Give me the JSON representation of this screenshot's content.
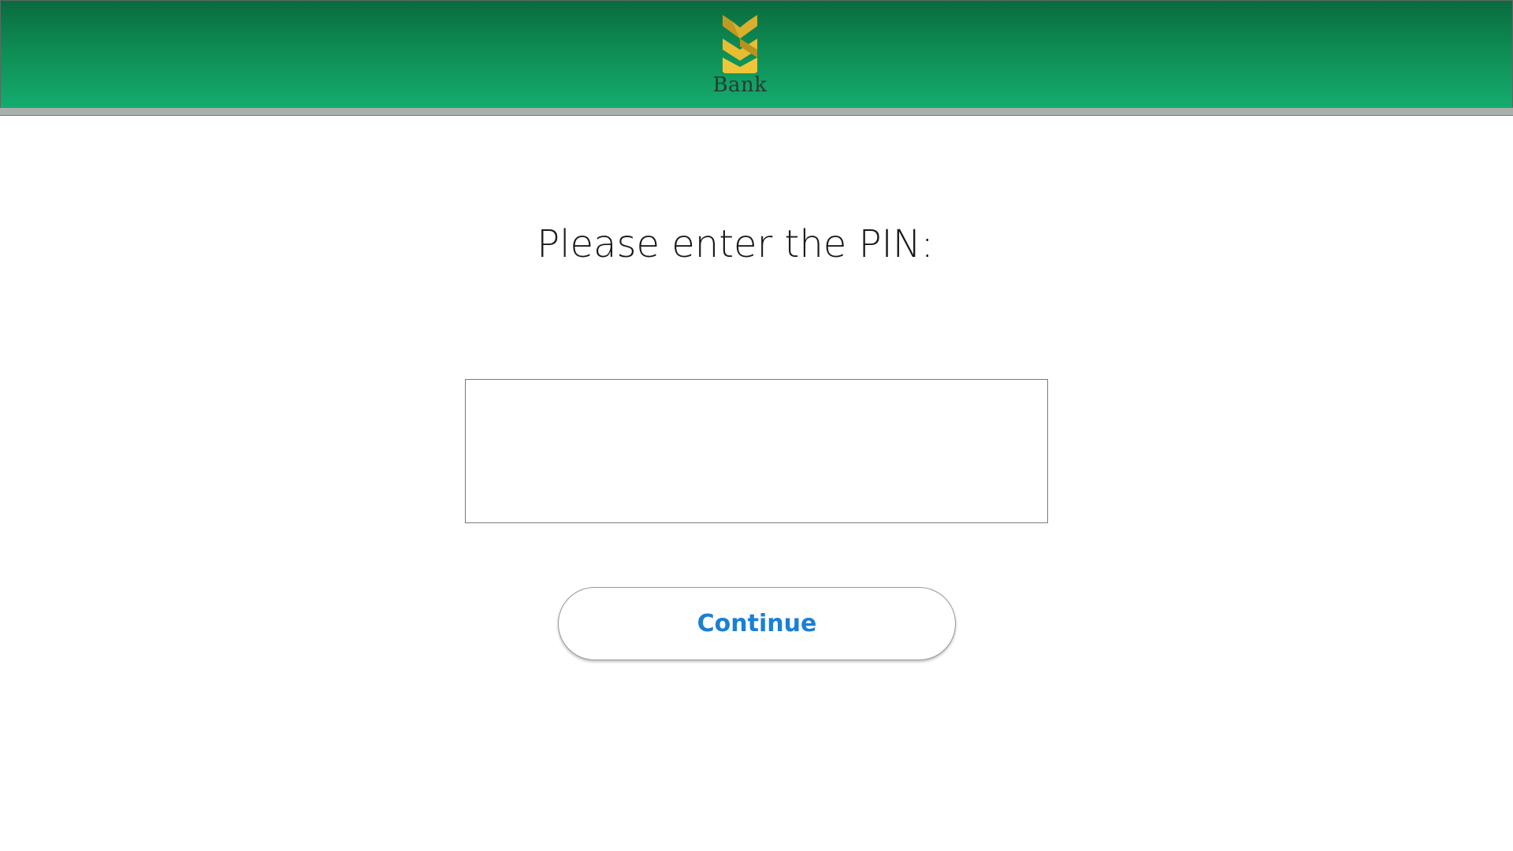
{
  "header": {
    "logo_text": "Bank",
    "logo_icon": "bank-logo-icon",
    "colors": {
      "gradient_top": "#0a6b3f",
      "gradient_bottom": "#15ab6f",
      "logo_gold_dark": "#b8921f",
      "logo_gold_light": "#f0c53a"
    }
  },
  "main": {
    "prompt": "Please enter the PIN:",
    "pin_value": "",
    "continue_label": "Continue",
    "continue_color": "#1a7fd6"
  }
}
